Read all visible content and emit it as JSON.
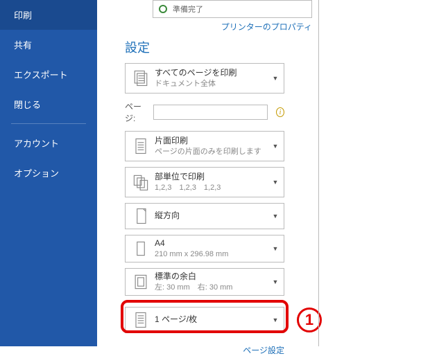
{
  "sidebar": {
    "items": [
      {
        "label": "印刷",
        "active": true
      },
      {
        "label": "共有",
        "active": false
      },
      {
        "label": "エクスポート",
        "active": false
      },
      {
        "label": "閉じる",
        "active": false
      }
    ],
    "items2": [
      {
        "label": "アカウント"
      },
      {
        "label": "オプション"
      }
    ]
  },
  "printer": {
    "status": "準備完了",
    "properties_link": "プリンターのプロパティ"
  },
  "settings": {
    "title": "設定",
    "pages_label": "ページ:",
    "pages_value": "",
    "info_tooltip": "i",
    "page_setup_link": "ページ設定",
    "items": {
      "print_all": {
        "title": "すべてのページを印刷",
        "sub": "ドキュメント全体"
      },
      "one_sided": {
        "title": "片面印刷",
        "sub": "ページの片面のみを印刷します"
      },
      "collated": {
        "title": "部単位で印刷",
        "sub": "1,2,3　1,2,3　1,2,3"
      },
      "orientation": {
        "title": "縦方向",
        "sub": ""
      },
      "paper": {
        "title": "A4",
        "sub": "210 mm x 296.98 mm"
      },
      "margins": {
        "title": "標準の余白",
        "sub": "左: 30 mm　右: 30 mm"
      },
      "pages_per_sheet": {
        "title": "1 ページ/枚",
        "sub": ""
      }
    }
  },
  "annotation": {
    "label": "1"
  }
}
